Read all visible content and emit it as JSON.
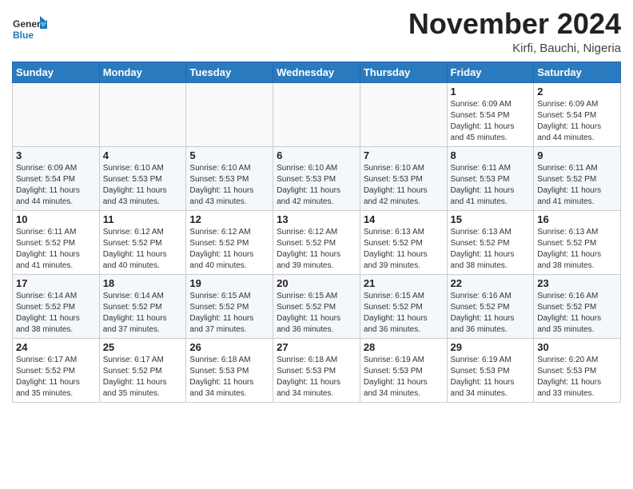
{
  "header": {
    "logo_general": "General",
    "logo_blue": "Blue",
    "month": "November 2024",
    "location": "Kirfi, Bauchi, Nigeria"
  },
  "weekdays": [
    "Sunday",
    "Monday",
    "Tuesday",
    "Wednesday",
    "Thursday",
    "Friday",
    "Saturday"
  ],
  "weeks": [
    [
      {
        "day": "",
        "info": ""
      },
      {
        "day": "",
        "info": ""
      },
      {
        "day": "",
        "info": ""
      },
      {
        "day": "",
        "info": ""
      },
      {
        "day": "",
        "info": ""
      },
      {
        "day": "1",
        "info": "Sunrise: 6:09 AM\nSunset: 5:54 PM\nDaylight: 11 hours\nand 45 minutes."
      },
      {
        "day": "2",
        "info": "Sunrise: 6:09 AM\nSunset: 5:54 PM\nDaylight: 11 hours\nand 44 minutes."
      }
    ],
    [
      {
        "day": "3",
        "info": "Sunrise: 6:09 AM\nSunset: 5:54 PM\nDaylight: 11 hours\nand 44 minutes."
      },
      {
        "day": "4",
        "info": "Sunrise: 6:10 AM\nSunset: 5:53 PM\nDaylight: 11 hours\nand 43 minutes."
      },
      {
        "day": "5",
        "info": "Sunrise: 6:10 AM\nSunset: 5:53 PM\nDaylight: 11 hours\nand 43 minutes."
      },
      {
        "day": "6",
        "info": "Sunrise: 6:10 AM\nSunset: 5:53 PM\nDaylight: 11 hours\nand 42 minutes."
      },
      {
        "day": "7",
        "info": "Sunrise: 6:10 AM\nSunset: 5:53 PM\nDaylight: 11 hours\nand 42 minutes."
      },
      {
        "day": "8",
        "info": "Sunrise: 6:11 AM\nSunset: 5:53 PM\nDaylight: 11 hours\nand 41 minutes."
      },
      {
        "day": "9",
        "info": "Sunrise: 6:11 AM\nSunset: 5:52 PM\nDaylight: 11 hours\nand 41 minutes."
      }
    ],
    [
      {
        "day": "10",
        "info": "Sunrise: 6:11 AM\nSunset: 5:52 PM\nDaylight: 11 hours\nand 41 minutes."
      },
      {
        "day": "11",
        "info": "Sunrise: 6:12 AM\nSunset: 5:52 PM\nDaylight: 11 hours\nand 40 minutes."
      },
      {
        "day": "12",
        "info": "Sunrise: 6:12 AM\nSunset: 5:52 PM\nDaylight: 11 hours\nand 40 minutes."
      },
      {
        "day": "13",
        "info": "Sunrise: 6:12 AM\nSunset: 5:52 PM\nDaylight: 11 hours\nand 39 minutes."
      },
      {
        "day": "14",
        "info": "Sunrise: 6:13 AM\nSunset: 5:52 PM\nDaylight: 11 hours\nand 39 minutes."
      },
      {
        "day": "15",
        "info": "Sunrise: 6:13 AM\nSunset: 5:52 PM\nDaylight: 11 hours\nand 38 minutes."
      },
      {
        "day": "16",
        "info": "Sunrise: 6:13 AM\nSunset: 5:52 PM\nDaylight: 11 hours\nand 38 minutes."
      }
    ],
    [
      {
        "day": "17",
        "info": "Sunrise: 6:14 AM\nSunset: 5:52 PM\nDaylight: 11 hours\nand 38 minutes."
      },
      {
        "day": "18",
        "info": "Sunrise: 6:14 AM\nSunset: 5:52 PM\nDaylight: 11 hours\nand 37 minutes."
      },
      {
        "day": "19",
        "info": "Sunrise: 6:15 AM\nSunset: 5:52 PM\nDaylight: 11 hours\nand 37 minutes."
      },
      {
        "day": "20",
        "info": "Sunrise: 6:15 AM\nSunset: 5:52 PM\nDaylight: 11 hours\nand 36 minutes."
      },
      {
        "day": "21",
        "info": "Sunrise: 6:15 AM\nSunset: 5:52 PM\nDaylight: 11 hours\nand 36 minutes."
      },
      {
        "day": "22",
        "info": "Sunrise: 6:16 AM\nSunset: 5:52 PM\nDaylight: 11 hours\nand 36 minutes."
      },
      {
        "day": "23",
        "info": "Sunrise: 6:16 AM\nSunset: 5:52 PM\nDaylight: 11 hours\nand 35 minutes."
      }
    ],
    [
      {
        "day": "24",
        "info": "Sunrise: 6:17 AM\nSunset: 5:52 PM\nDaylight: 11 hours\nand 35 minutes."
      },
      {
        "day": "25",
        "info": "Sunrise: 6:17 AM\nSunset: 5:52 PM\nDaylight: 11 hours\nand 35 minutes."
      },
      {
        "day": "26",
        "info": "Sunrise: 6:18 AM\nSunset: 5:53 PM\nDaylight: 11 hours\nand 34 minutes."
      },
      {
        "day": "27",
        "info": "Sunrise: 6:18 AM\nSunset: 5:53 PM\nDaylight: 11 hours\nand 34 minutes."
      },
      {
        "day": "28",
        "info": "Sunrise: 6:19 AM\nSunset: 5:53 PM\nDaylight: 11 hours\nand 34 minutes."
      },
      {
        "day": "29",
        "info": "Sunrise: 6:19 AM\nSunset: 5:53 PM\nDaylight: 11 hours\nand 34 minutes."
      },
      {
        "day": "30",
        "info": "Sunrise: 6:20 AM\nSunset: 5:53 PM\nDaylight: 11 hours\nand 33 minutes."
      }
    ]
  ]
}
